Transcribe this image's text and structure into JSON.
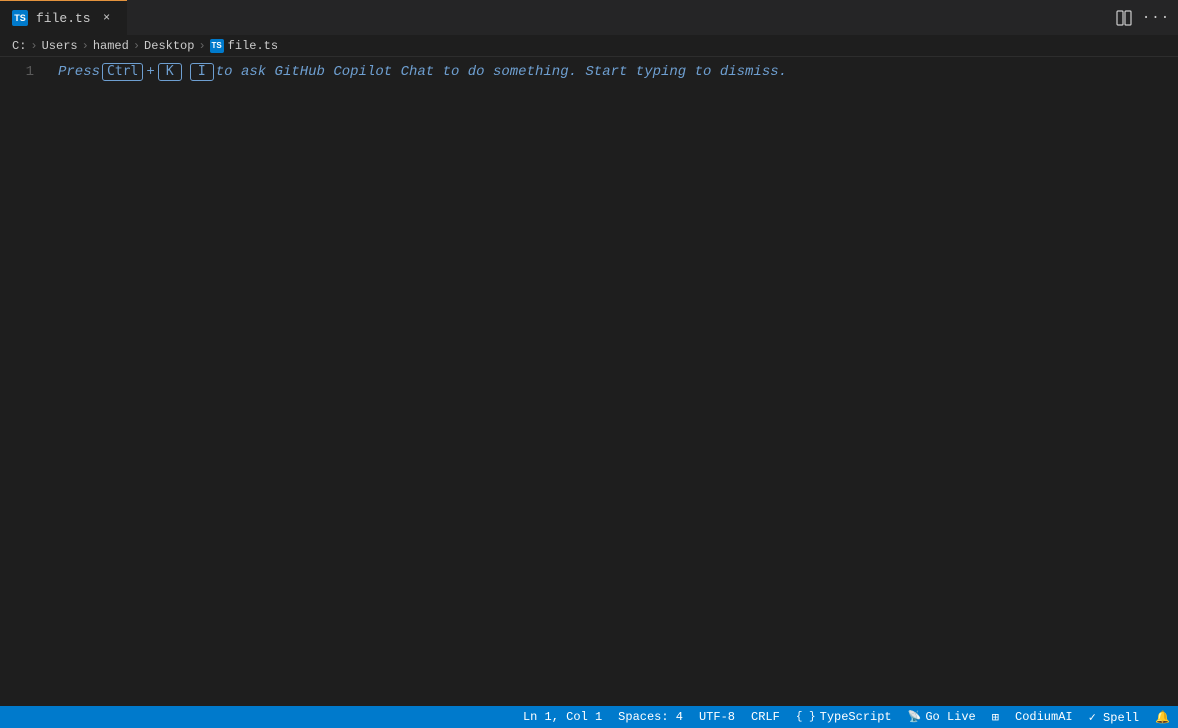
{
  "tab": {
    "icon_text": "TS",
    "label": "file.ts",
    "close_symbol": "×"
  },
  "tab_actions": {
    "split_symbol": "⊡",
    "more_symbol": "···"
  },
  "breadcrumb": {
    "items": [
      "C:",
      "Users",
      "hamed",
      "Desktop",
      "file.ts"
    ],
    "separators": [
      "›",
      "›",
      "›",
      "›"
    ]
  },
  "editor": {
    "line_number": "1",
    "hint": {
      "press": "Press",
      "ctrl": "Ctrl",
      "plus": "+",
      "k": "K",
      "i": "I",
      "rest": " to ask GitHub Copilot Chat to do something. Start typing to dismiss."
    }
  },
  "statusbar": {
    "position": "Ln 1, Col 1",
    "spaces": "Spaces: 4",
    "encoding": "UTF-8",
    "line_ending": "CRLF",
    "language_icon": "{ }",
    "language": "TypeScript",
    "golive_icon": "📡",
    "golive": "Go Live",
    "extensions_icon": "⊞",
    "codiumai": "CodiumAI",
    "spell_check": "✓ Spell",
    "bell_icon": "🔔"
  }
}
